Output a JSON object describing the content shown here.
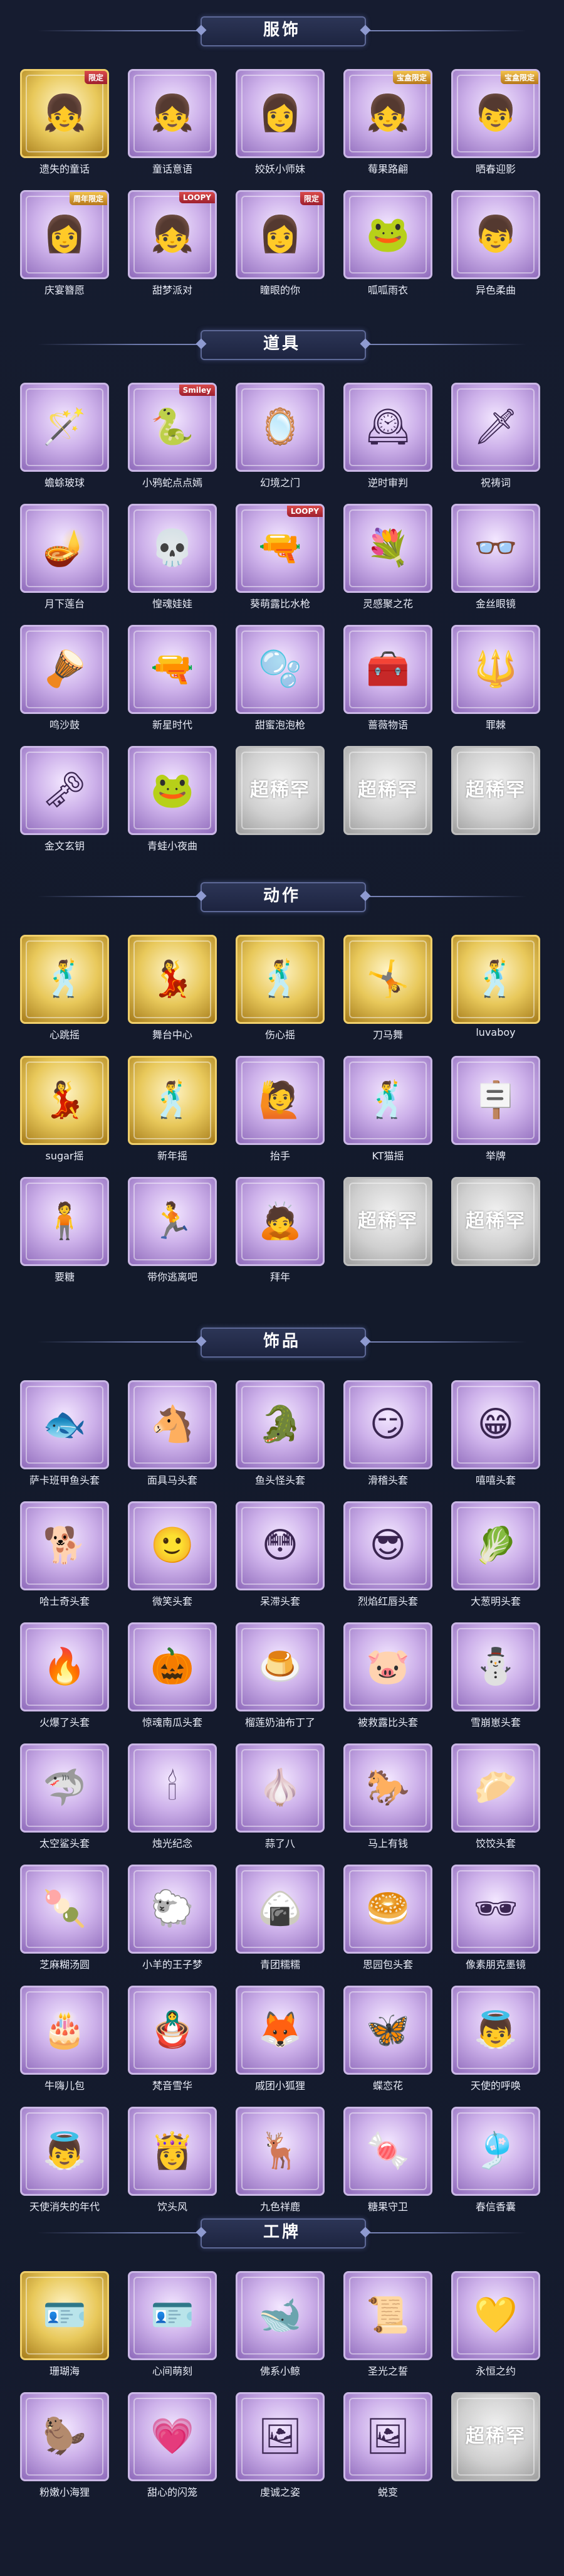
{
  "sections": [
    {
      "title": "服饰",
      "items": [
        {
          "name": "遗失的童话",
          "style": "gold",
          "badge": "限定",
          "icon": "girl-avatar-icon",
          "glyph": "👧"
        },
        {
          "name": "童话意语",
          "style": "purple",
          "icon": "girl-avatar-icon",
          "glyph": "👧"
        },
        {
          "name": "姣妖小师妹",
          "style": "purple",
          "icon": "girl-avatar-icon",
          "glyph": "👩"
        },
        {
          "name": "莓果路翩",
          "style": "purple",
          "badge": "宝盒限定",
          "badgeStyle": "gold",
          "icon": "girl-avatar-icon",
          "glyph": "👧"
        },
        {
          "name": "晒春迎影",
          "style": "purple",
          "badge": "宝盒限定",
          "badgeStyle": "gold",
          "icon": "boy-avatar-icon",
          "glyph": "👦"
        },
        {
          "name": "庆宴簪愿",
          "style": "purple",
          "badge": "周年限定",
          "badgeStyle": "gold",
          "icon": "girl-avatar-icon",
          "glyph": "👩"
        },
        {
          "name": "甜梦派对",
          "style": "purple",
          "badge": "LOOPY",
          "icon": "girl-avatar-icon",
          "glyph": "👧"
        },
        {
          "name": "瞳眼的你",
          "style": "purple",
          "badge": "限定",
          "icon": "girl-avatar-icon",
          "glyph": "👩"
        },
        {
          "name": "呱呱雨衣",
          "style": "purple",
          "icon": "frog-hood-icon",
          "glyph": "🐸"
        },
        {
          "name": "异色柔曲",
          "style": "purple",
          "icon": "boy-avatar-icon",
          "glyph": "👦"
        }
      ]
    },
    {
      "title": "道具",
      "items": [
        {
          "name": "蟾蜍玻球",
          "style": "purple",
          "icon": "wand-icon",
          "glyph": "🪄"
        },
        {
          "name": "小鸦蛇点点嫣",
          "style": "purple",
          "badge": "Smiley",
          "icon": "snake-icon",
          "glyph": "🐍"
        },
        {
          "name": "幻境之门",
          "style": "purple",
          "icon": "mirror-icon",
          "glyph": "🪞"
        },
        {
          "name": "逆时审判",
          "style": "purple",
          "icon": "clock-icon",
          "glyph": "🕰"
        },
        {
          "name": "祝祷词",
          "style": "purple",
          "icon": "sword-icon",
          "glyph": "🗡"
        },
        {
          "name": "月下莲台",
          "style": "purple",
          "icon": "lamp-icon",
          "glyph": "🪔"
        },
        {
          "name": "惶魂娃娃",
          "style": "purple",
          "icon": "skull-icon",
          "glyph": "💀"
        },
        {
          "name": "葵萌露比水枪",
          "style": "purple",
          "badge": "LOOPY",
          "icon": "water-gun-icon",
          "glyph": "🔫"
        },
        {
          "name": "灵感聚之花",
          "style": "purple",
          "icon": "bouquet-icon",
          "glyph": "💐"
        },
        {
          "name": "金丝眼镜",
          "style": "purple",
          "icon": "glasses-icon",
          "glyph": "👓"
        },
        {
          "name": "鸣沙鼓",
          "style": "purple",
          "icon": "drum-icon",
          "glyph": "🪘"
        },
        {
          "name": "新星时代",
          "style": "purple",
          "icon": "revolver-icon",
          "glyph": "🔫"
        },
        {
          "name": "甜蜜泡泡枪",
          "style": "purple",
          "icon": "bubble-gun-icon",
          "glyph": "🫧"
        },
        {
          "name": "蔷薇物语",
          "style": "purple",
          "icon": "chest-icon",
          "glyph": "🧰"
        },
        {
          "name": "罪棘",
          "style": "purple",
          "icon": "spear-icon",
          "glyph": "🔱"
        },
        {
          "name": "金文玄钥",
          "style": "purple",
          "icon": "key-icon",
          "glyph": "🗝"
        },
        {
          "name": "青蛙小夜曲",
          "style": "purple",
          "icon": "frog-icon",
          "glyph": "🐸"
        },
        {
          "name": "",
          "style": "empty",
          "icon": "placeholder-icon",
          "glyph": "超稀罕"
        },
        {
          "name": "",
          "style": "empty",
          "icon": "placeholder-icon",
          "glyph": "超稀罕"
        },
        {
          "name": "",
          "style": "empty",
          "icon": "placeholder-icon",
          "glyph": "超稀罕"
        }
      ]
    },
    {
      "title": "动作",
      "items": [
        {
          "name": "心跳摇",
          "style": "gold",
          "icon": "pose-icon",
          "glyph": "🕺"
        },
        {
          "name": "舞台中心",
          "style": "gold",
          "icon": "pose-icon",
          "glyph": "💃"
        },
        {
          "name": "伤心摇",
          "style": "gold",
          "icon": "pose-icon",
          "glyph": "🕺"
        },
        {
          "name": "刀马舞",
          "style": "gold",
          "icon": "pose-icon",
          "glyph": "🤸"
        },
        {
          "name": "luvaboy",
          "style": "gold",
          "icon": "pose-icon",
          "glyph": "🕺"
        },
        {
          "name": "sugar摇",
          "style": "gold",
          "icon": "pose-icon",
          "glyph": "💃"
        },
        {
          "name": "新年摇",
          "style": "gold",
          "icon": "pose-icon",
          "glyph": "🕺"
        },
        {
          "name": "抬手",
          "style": "purple",
          "icon": "pose-icon",
          "glyph": "🙋"
        },
        {
          "name": "KT猫摇",
          "style": "purple",
          "icon": "pose-icon",
          "glyph": "🕺"
        },
        {
          "name": "举牌",
          "style": "purple",
          "icon": "pose-icon",
          "glyph": "🪧"
        },
        {
          "name": "要糖",
          "style": "purple",
          "icon": "pose-icon",
          "glyph": "🧍"
        },
        {
          "name": "带你逃离吧",
          "style": "purple",
          "icon": "pose-icon",
          "glyph": "🏃"
        },
        {
          "name": "拜年",
          "style": "purple",
          "icon": "pose-icon",
          "glyph": "🙇"
        },
        {
          "name": "",
          "style": "empty",
          "icon": "placeholder-icon",
          "glyph": "超稀罕"
        },
        {
          "name": "",
          "style": "empty",
          "icon": "placeholder-icon",
          "glyph": "超稀罕"
        }
      ]
    },
    {
      "title": "饰品",
      "items": [
        {
          "name": "萨卡班甲鱼头套",
          "style": "purple",
          "icon": "fish-head-icon",
          "glyph": "🐟"
        },
        {
          "name": "面具马头套",
          "style": "purple",
          "icon": "horse-head-icon",
          "glyph": "🐴"
        },
        {
          "name": "鱼头怪头套",
          "style": "purple",
          "icon": "fish-monster-icon",
          "glyph": "🐊"
        },
        {
          "name": "滑稽头套",
          "style": "purple",
          "icon": "smirk-emoji-icon",
          "glyph": "😏"
        },
        {
          "name": "嘻嘻头套",
          "style": "purple",
          "icon": "grin-emoji-icon",
          "glyph": "😁"
        },
        {
          "name": "哈士奇头套",
          "style": "purple",
          "icon": "husky-head-icon",
          "glyph": "🐕"
        },
        {
          "name": "微笑头套",
          "style": "purple",
          "icon": "smile-emoji-icon",
          "glyph": "🙂"
        },
        {
          "name": "呆滞头套",
          "style": "purple",
          "icon": "stare-emoji-icon",
          "glyph": "😳"
        },
        {
          "name": "烈焰红唇头套",
          "style": "purple",
          "icon": "pikachu-head-icon",
          "glyph": "😎"
        },
        {
          "name": "大葱明头套",
          "style": "purple",
          "icon": "onion-head-icon",
          "glyph": "🥬"
        },
        {
          "name": "火爆了头套",
          "style": "purple",
          "icon": "fire-head-icon",
          "glyph": "🔥"
        },
        {
          "name": "惊魂南瓜头套",
          "style": "purple",
          "icon": "pumpkin-head-icon",
          "glyph": "🎃"
        },
        {
          "name": "榴莲奶油布丁了",
          "style": "purple",
          "icon": "pudding-icon",
          "glyph": "🍮"
        },
        {
          "name": "被救露比头套",
          "style": "purple",
          "icon": "beaver-head-icon",
          "glyph": "🐷"
        },
        {
          "name": "雪崩崽头套",
          "style": "purple",
          "icon": "snow-head-icon",
          "glyph": "⛄"
        },
        {
          "name": "太空鲨头套",
          "style": "purple",
          "icon": "shark-head-icon",
          "glyph": "🦈"
        },
        {
          "name": "烛光纪念",
          "style": "purple",
          "icon": "candle-icon",
          "glyph": "🕯"
        },
        {
          "name": "蒜了八",
          "style": "purple",
          "icon": "garlic-icon",
          "glyph": "🧄"
        },
        {
          "name": "马上有钱",
          "style": "purple",
          "icon": "horse-icon",
          "glyph": "🐎"
        },
        {
          "name": "饺饺头套",
          "style": "purple",
          "icon": "dumpling-icon",
          "glyph": "🥟"
        },
        {
          "name": "芝麻糊汤圆",
          "style": "purple",
          "icon": "tangyuan-icon",
          "glyph": "🍡"
        },
        {
          "name": "小羊的王子梦",
          "style": "purple",
          "icon": "sheep-head-icon",
          "glyph": "🐑"
        },
        {
          "name": "青团糯糯",
          "style": "purple",
          "icon": "qingtuan-icon",
          "glyph": "🍙"
        },
        {
          "name": "思园包头套",
          "style": "purple",
          "icon": "bun-icon",
          "glyph": "🥯"
        },
        {
          "name": "像素朋克墨镜",
          "style": "purple",
          "icon": "pixel-sunglasses-icon",
          "glyph": "🕶"
        },
        {
          "name": "牛嗨儿包",
          "style": "purple",
          "icon": "cake-icon",
          "glyph": "🎂"
        },
        {
          "name": "梵音雪华",
          "style": "purple",
          "icon": "doll-icon",
          "glyph": "🪆"
        },
        {
          "name": "戚团小狐狸",
          "style": "purple",
          "icon": "fox-icon",
          "glyph": "🦊"
        },
        {
          "name": "蝶恋花",
          "style": "purple",
          "icon": "butterfly-icon",
          "glyph": "🦋"
        },
        {
          "name": "天使的呼唤",
          "style": "purple",
          "icon": "angel-icon",
          "glyph": "👼"
        },
        {
          "name": "天使消失的年代",
          "style": "purple",
          "icon": "angel-icon",
          "glyph": "👼"
        },
        {
          "name": "饮头风",
          "style": "purple",
          "icon": "headdress-icon",
          "glyph": "👸"
        },
        {
          "name": "九色祥鹿",
          "style": "purple",
          "icon": "deer-icon",
          "glyph": "🦌"
        },
        {
          "name": "糖果守卫",
          "style": "purple",
          "icon": "candy-icon",
          "glyph": "🍬"
        },
        {
          "name": "春信香囊",
          "style": "purple",
          "icon": "sachet-icon",
          "glyph": "🎐"
        }
      ]
    },
    {
      "title": "工牌",
      "items": [
        {
          "name": "珊瑚海",
          "style": "gold",
          "icon": "badge-card-icon",
          "glyph": "🪪"
        },
        {
          "name": "心间萌刻",
          "style": "purple",
          "icon": "badge-card-icon",
          "glyph": "🪪"
        },
        {
          "name": "佛系小鲸",
          "style": "purple",
          "icon": "badge-card-icon",
          "glyph": "🐋"
        },
        {
          "name": "圣光之誓",
          "style": "purple",
          "icon": "badge-card-icon",
          "glyph": "📜"
        },
        {
          "name": "永恒之约",
          "style": "purple",
          "icon": "badge-card-icon",
          "glyph": "💛"
        },
        {
          "name": "粉嫩小海狸",
          "style": "purple",
          "icon": "badge-card-icon",
          "glyph": "🦫"
        },
        {
          "name": "甜心的闪笼",
          "style": "purple",
          "icon": "badge-card-icon",
          "glyph": "💗"
        },
        {
          "name": "虔诚之姿",
          "style": "purple",
          "icon": "badge-card-icon",
          "glyph": "🖼"
        },
        {
          "name": "蜕变",
          "style": "purple",
          "icon": "badge-card-icon",
          "glyph": "🖼"
        },
        {
          "name": "",
          "style": "empty",
          "icon": "placeholder-icon",
          "glyph": "超稀罕"
        }
      ]
    }
  ]
}
